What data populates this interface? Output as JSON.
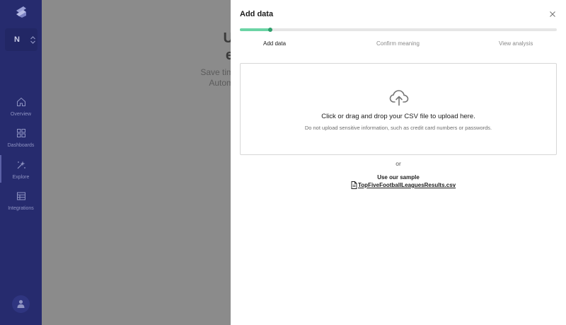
{
  "sidebar": {
    "workspace_initial": "N",
    "items": [
      {
        "label": "Overview",
        "icon": "home-icon"
      },
      {
        "label": "Dashboards",
        "icon": "grid-icon"
      },
      {
        "label": "Explore",
        "icon": "explore-icon",
        "active": true
      },
      {
        "label": "Integrations",
        "icon": "table-icon"
      }
    ]
  },
  "background": {
    "heading_lines": [
      "U",
      "e"
    ],
    "sub_lines": [
      "Save tim",
      "Autom"
    ]
  },
  "modal": {
    "title": "Add data",
    "progress": 0.095,
    "steps": [
      {
        "label": "Add data",
        "state": "active"
      },
      {
        "label": "Confirm meaning",
        "state": "inactive"
      },
      {
        "label": "View analysis",
        "state": "inactive"
      }
    ],
    "dropzone": {
      "title": "Click or drag and drop your CSV file to upload here.",
      "note": "Do not upload sensitive information, such as credit card numbers or passwords."
    },
    "or_text": "or",
    "sample": {
      "label": "Use our sample",
      "filename": "TopFiveFootballLeaguesResults.csv"
    }
  },
  "colors": {
    "sidebar_bg": "#262b6e",
    "progress_fill": "#6bd4a5",
    "progress_dot": "#2f9f6c"
  }
}
